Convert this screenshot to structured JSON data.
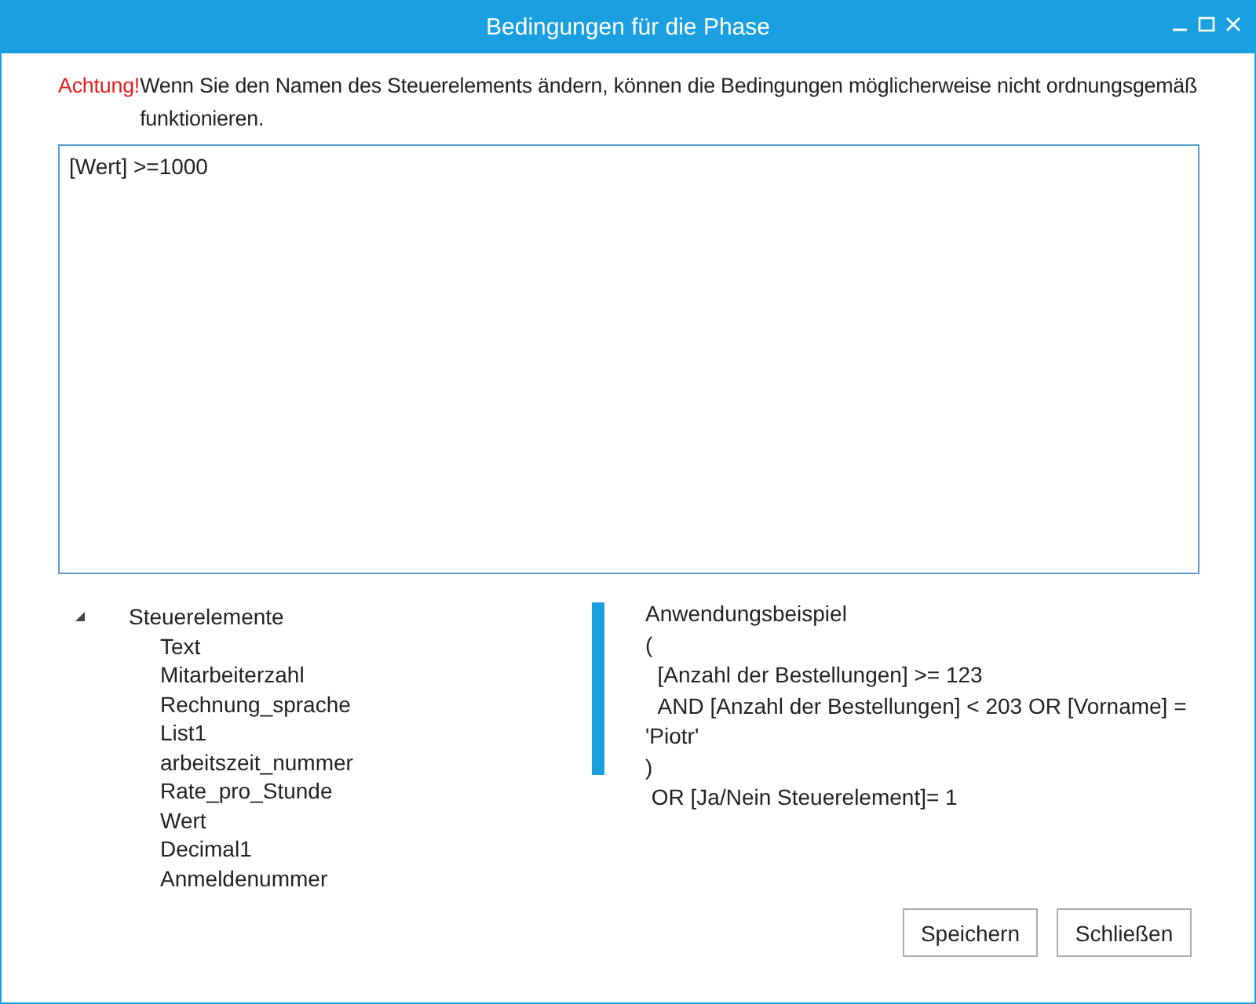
{
  "window": {
    "title": "Bedingungen für die Phase"
  },
  "warning": {
    "label": "Achtung!",
    "message": "Wenn Sie den Namen des Steuerelements ändern, können die Bedingungen möglicherweise nicht ordnungsgemäß funktionieren."
  },
  "editor": {
    "value": "[Wert] >=1000"
  },
  "tree": {
    "label": "Steuerelemente",
    "expanded": true,
    "children": [
      {
        "label": "Text"
      },
      {
        "label": "Mitarbeiterzahl"
      },
      {
        "label": "Rechnung_sprache"
      },
      {
        "label": "List1"
      },
      {
        "label": "arbeitszeit_nummer"
      },
      {
        "label": "Rate_pro_Stunde"
      },
      {
        "label": "Wert"
      },
      {
        "label": "Decimal1"
      },
      {
        "label": "Anmeldenummer"
      }
    ]
  },
  "example": {
    "title": "Anwendungsbeispiel",
    "lines": [
      "(",
      "  [Anzahl der Bestellungen] >= 123",
      "  AND [Anzahl der Bestellungen] < 203 OR [Vorname] = 'Piotr'",
      ")",
      " OR [Ja/Nein Steuerelement]= 1"
    ]
  },
  "buttons": [
    "Speichern",
    "Schließen"
  ]
}
